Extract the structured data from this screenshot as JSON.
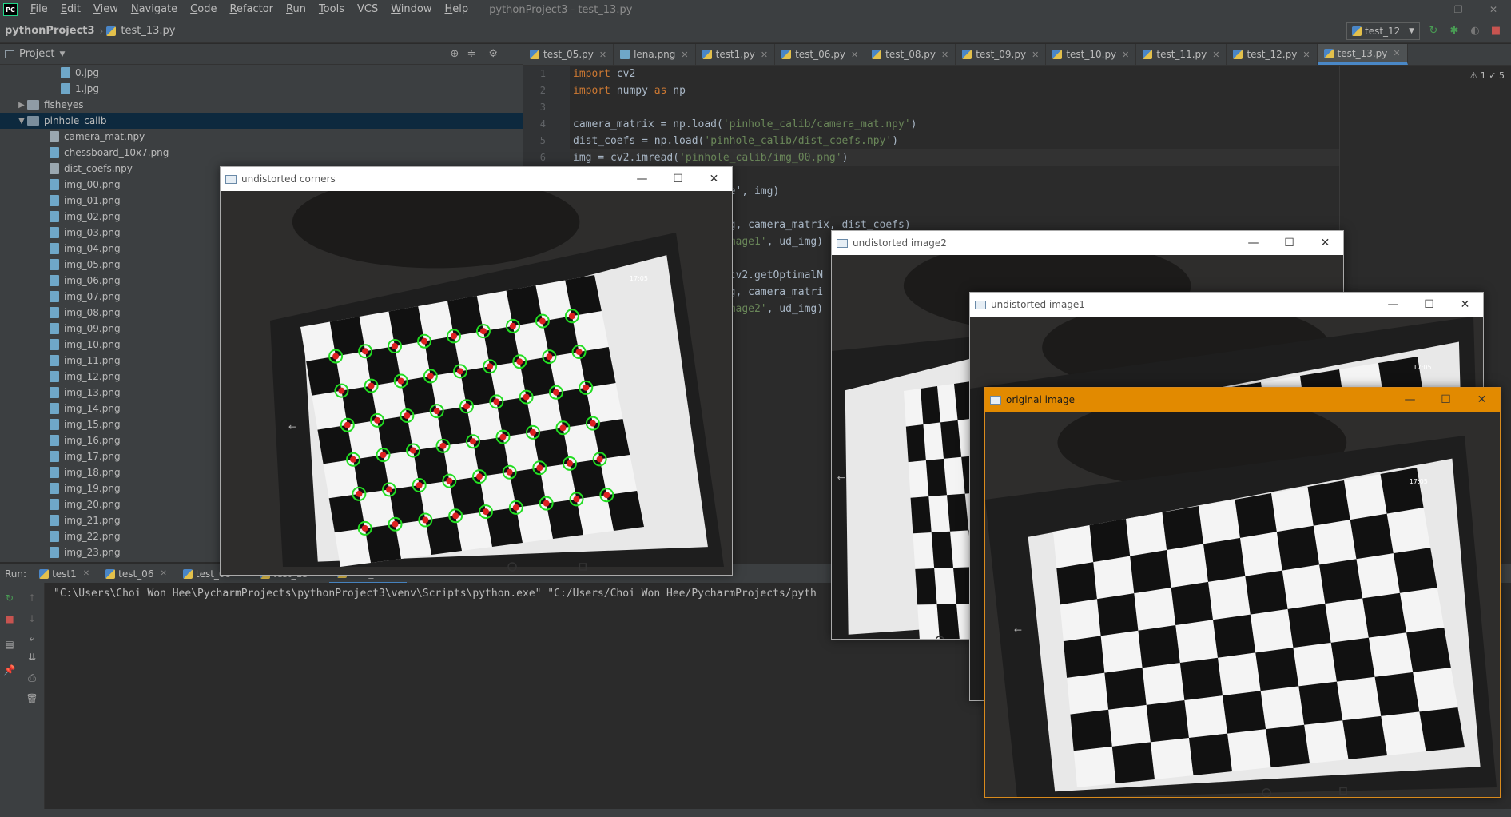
{
  "menubar": {
    "logo": "PC",
    "items": [
      {
        "u": "F",
        "rest": "ile"
      },
      {
        "u": "E",
        "rest": "dit"
      },
      {
        "u": "V",
        "rest": "iew"
      },
      {
        "u": "N",
        "rest": "avigate"
      },
      {
        "u": "C",
        "rest": "ode"
      },
      {
        "u": "R",
        "rest": "efactor"
      },
      {
        "u": "R",
        "rest": "un"
      },
      {
        "u": "T",
        "rest": "ools"
      },
      {
        "u": "",
        "rest": "VCS"
      },
      {
        "u": "W",
        "rest": "indow"
      },
      {
        "u": "H",
        "rest": "elp"
      }
    ],
    "window_title": "pythonProject3 - test_13.py"
  },
  "navbar": {
    "project": "pythonProject3",
    "file": "test_13.py",
    "run_config": "test_12"
  },
  "project_panel": {
    "title": "Project",
    "tree": [
      {
        "label": "0.jpg",
        "type": "img",
        "indent": 4
      },
      {
        "label": "1.jpg",
        "type": "img",
        "indent": 4
      },
      {
        "label": "fisheyes",
        "type": "folder",
        "indent": 1,
        "arrow": "▶"
      },
      {
        "label": "pinhole_calib",
        "type": "folder-open",
        "indent": 1,
        "arrow": "▼",
        "selected": true
      },
      {
        "label": "camera_mat.npy",
        "type": "file",
        "indent": 3
      },
      {
        "label": "chessboard_10x7.png",
        "type": "img",
        "indent": 3
      },
      {
        "label": "dist_coefs.npy",
        "type": "file",
        "indent": 3
      },
      {
        "label": "img_00.png",
        "type": "img",
        "indent": 3
      },
      {
        "label": "img_01.png",
        "type": "img",
        "indent": 3
      },
      {
        "label": "img_02.png",
        "type": "img",
        "indent": 3
      },
      {
        "label": "img_03.png",
        "type": "img",
        "indent": 3
      },
      {
        "label": "img_04.png",
        "type": "img",
        "indent": 3
      },
      {
        "label": "img_05.png",
        "type": "img",
        "indent": 3
      },
      {
        "label": "img_06.png",
        "type": "img",
        "indent": 3
      },
      {
        "label": "img_07.png",
        "type": "img",
        "indent": 3
      },
      {
        "label": "img_08.png",
        "type": "img",
        "indent": 3
      },
      {
        "label": "img_09.png",
        "type": "img",
        "indent": 3
      },
      {
        "label": "img_10.png",
        "type": "img",
        "indent": 3
      },
      {
        "label": "img_11.png",
        "type": "img",
        "indent": 3
      },
      {
        "label": "img_12.png",
        "type": "img",
        "indent": 3
      },
      {
        "label": "img_13.png",
        "type": "img",
        "indent": 3
      },
      {
        "label": "img_14.png",
        "type": "img",
        "indent": 3
      },
      {
        "label": "img_15.png",
        "type": "img",
        "indent": 3
      },
      {
        "label": "img_16.png",
        "type": "img",
        "indent": 3
      },
      {
        "label": "img_17.png",
        "type": "img",
        "indent": 3
      },
      {
        "label": "img_18.png",
        "type": "img",
        "indent": 3
      },
      {
        "label": "img_19.png",
        "type": "img",
        "indent": 3
      },
      {
        "label": "img_20.png",
        "type": "img",
        "indent": 3
      },
      {
        "label": "img_21.png",
        "type": "img",
        "indent": 3
      },
      {
        "label": "img_22.png",
        "type": "img",
        "indent": 3
      },
      {
        "label": "img_23.png",
        "type": "img",
        "indent": 3
      }
    ]
  },
  "editor": {
    "tabs": [
      {
        "label": "test_05.py",
        "icon": "py"
      },
      {
        "label": "lena.png",
        "icon": "img"
      },
      {
        "label": "test1.py",
        "icon": "py"
      },
      {
        "label": "test_06.py",
        "icon": "py"
      },
      {
        "label": "test_08.py",
        "icon": "py"
      },
      {
        "label": "test_09.py",
        "icon": "py"
      },
      {
        "label": "test_10.py",
        "icon": "py"
      },
      {
        "label": "test_11.py",
        "icon": "py"
      },
      {
        "label": "test_12.py",
        "icon": "py"
      },
      {
        "label": "test_13.py",
        "icon": "py",
        "active": true
      }
    ],
    "inspections": "⚠ 1  ✓ 5",
    "line_numbers": [
      "1",
      "2",
      "3",
      "4",
      "5",
      "6"
    ],
    "code_lines": [
      [
        {
          "t": "import",
          "c": "kw"
        },
        {
          "t": " cv2"
        }
      ],
      [
        {
          "t": "import",
          "c": "kw"
        },
        {
          "t": " numpy "
        },
        {
          "t": "as",
          "c": "kw"
        },
        {
          "t": " np"
        }
      ],
      [
        {
          "t": ""
        }
      ],
      [
        {
          "t": "camera_matrix = np.load("
        },
        {
          "t": "'pinhole_calib/camera_mat.npy'",
          "c": "str"
        },
        {
          "t": ")"
        }
      ],
      [
        {
          "t": "dist_coefs = np.load("
        },
        {
          "t": "'pinhole_calib/dist_coefs.npy'",
          "c": "str"
        },
        {
          "t": ")"
        }
      ],
      [
        {
          "t": "img = cv2.imread("
        },
        {
          "t": "'pinhole_calib/img_00.png'",
          "c": "str"
        },
        {
          "t": ")"
        }
      ],
      [
        {
          "t": ""
        }
      ],
      [
        {
          "t": "                         e', img)"
        }
      ],
      [
        {
          "t": ""
        }
      ],
      [
        {
          "t": "                         g, camera_matrix, dist_coefs)"
        }
      ],
      [
        {
          "t": "                         "
        },
        {
          "t": "mage1'",
          "c": "str"
        },
        {
          "t": ", ud_img)"
        }
      ],
      [
        {
          "t": ""
        }
      ],
      [
        {
          "t": "                         cv2.getOptimalN"
        }
      ],
      [
        {
          "t": "                         g, camera_matri"
        }
      ],
      [
        {
          "t": "                         "
        },
        {
          "t": "mage2'",
          "c": "str"
        },
        {
          "t": ", ud_img)"
        }
      ]
    ]
  },
  "run_panel": {
    "label": "Run:",
    "tabs": [
      {
        "label": "test1"
      },
      {
        "label": "test_06"
      },
      {
        "label": "test_08"
      },
      {
        "label": "test_13"
      },
      {
        "label": "test_12",
        "active": true
      }
    ],
    "console_text": "\"C:\\Users\\Choi Won Hee\\PycharmProjects\\pythonProject3\\venv\\Scripts\\python.exe\" \"C:/Users/Choi Won Hee/PycharmProjects/pyth"
  },
  "cv_windows": {
    "corners": {
      "title": "undistorted corners"
    },
    "image2": {
      "title": "undistorted image2"
    },
    "image1": {
      "title": "undistorted image1"
    },
    "original": {
      "title": "original image"
    }
  },
  "phone_clock": "17:05"
}
